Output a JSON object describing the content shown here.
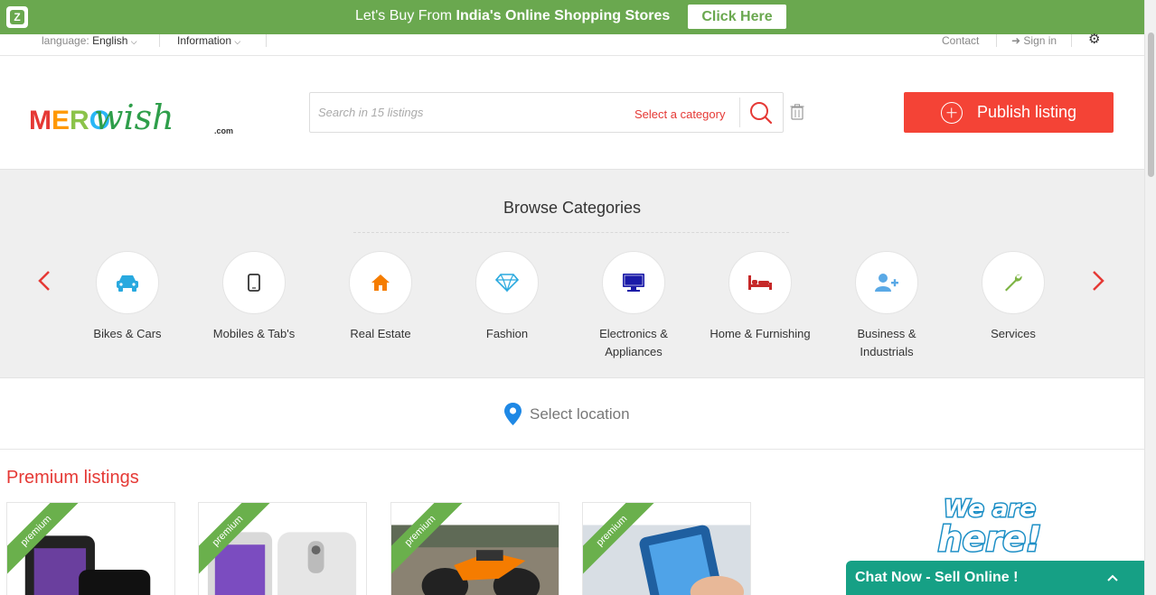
{
  "promo": {
    "text_light": "Let's Buy From ",
    "text_bold": "India's Online Shopping Stores",
    "cta": "Click Here"
  },
  "utility": {
    "language_label": "language:",
    "language_value": "English",
    "information": "Information",
    "contact": "Contact",
    "sign_in": "Sign in"
  },
  "header": {
    "logo_text": "MEROWISH",
    "logo_tld": ".com",
    "search_placeholder": "Search in 15 listings",
    "search_category": "Select a category",
    "publish_label": "Publish listing"
  },
  "categories": {
    "title": "Browse Categories",
    "items": [
      {
        "line1": "Bikes & Cars",
        "line2": "",
        "icon": "car-icon",
        "color": "#29a9df"
      },
      {
        "line1": "Mobiles & Tab's",
        "line2": "",
        "icon": "mobile-icon",
        "color": "#333333"
      },
      {
        "line1": "Real Estate",
        "line2": "",
        "icon": "home-icon",
        "color": "#f57c00"
      },
      {
        "line1": "Fashion",
        "line2": "",
        "icon": "diamond-icon",
        "color": "#29a9df"
      },
      {
        "line1": "Electronics &",
        "line2": "Appliances",
        "icon": "monitor-icon",
        "color": "#1a1aa8"
      },
      {
        "line1": "Home & Furnishing",
        "line2": "",
        "icon": "bed-icon",
        "color": "#c62828"
      },
      {
        "line1": "Business &",
        "line2": "Industrials",
        "icon": "user-plus-icon",
        "color": "#5aa9e6"
      },
      {
        "line1": "Services",
        "line2": "",
        "icon": "wrench-icon",
        "color": "#7cb342"
      }
    ]
  },
  "location": {
    "label": "Select location"
  },
  "premium": {
    "title": "Premium listings",
    "ribbon": "premium",
    "cards": [
      "phone",
      "phone",
      "motorbike",
      "tablet"
    ]
  },
  "we_are_here": "We are here!",
  "chat": {
    "label": "Chat Now - Sell Online !"
  },
  "colors": {
    "promo_bg": "#6aa84f",
    "accent_red": "#f44336",
    "chat_bg": "#16a085"
  }
}
